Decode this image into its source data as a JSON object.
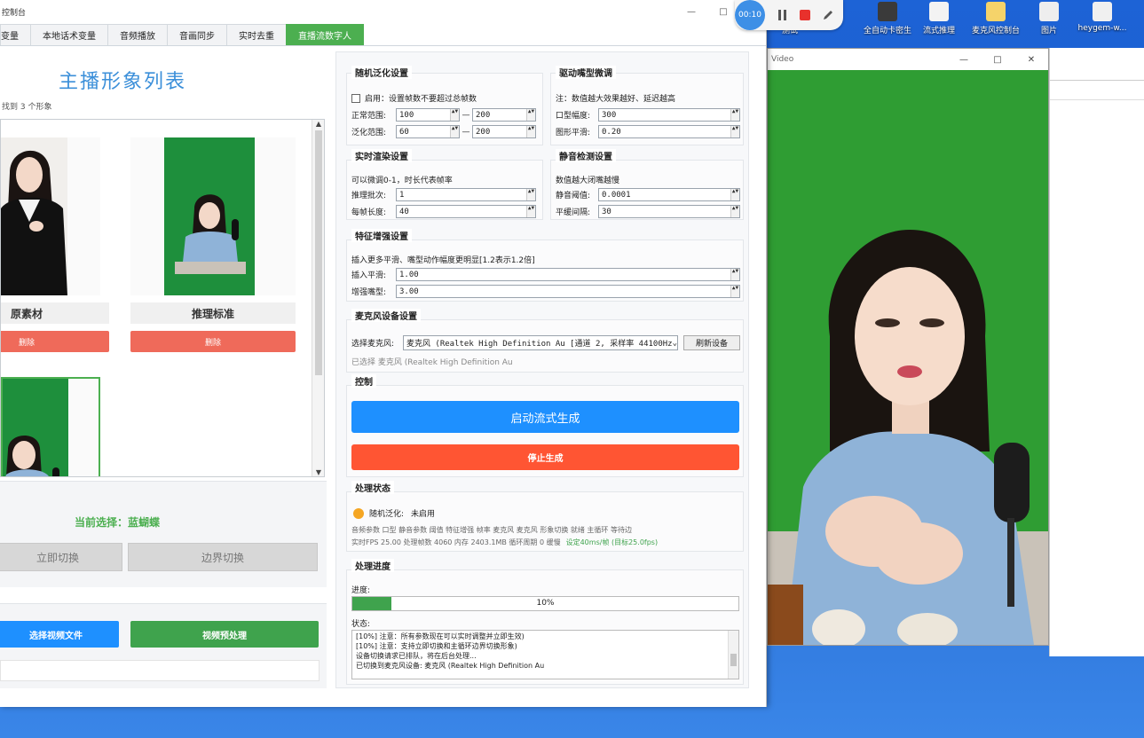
{
  "desktop": {
    "icons": [
      {
        "label": "测试",
        "color": "#d6d6d6"
      },
      {
        "label": "全自动卡密生",
        "color": "#3a3a3a"
      },
      {
        "label": "流式推理",
        "color": "#f3f3f3"
      },
      {
        "label": "麦克风控制台",
        "color": "#f5d36a"
      },
      {
        "label": "图片",
        "color": "#eeeeee"
      },
      {
        "label": "heygem-w...",
        "color": "#f0f0f0"
      }
    ]
  },
  "recorder": {
    "time": "00:10"
  },
  "window": {
    "title": "控制台",
    "min": "—",
    "max": "□",
    "close": "✕"
  },
  "tabs": [
    {
      "label": "变量",
      "active": false
    },
    {
      "label": "本地话术变量",
      "active": false
    },
    {
      "label": "音频播放",
      "active": false
    },
    {
      "label": "音画同步",
      "active": false
    },
    {
      "label": "实时去重",
      "active": false
    },
    {
      "label": "直播流数字人",
      "active": true
    }
  ],
  "left": {
    "title": "主播形象列表",
    "count_text": "找到 3 个形象",
    "avatars": [
      {
        "name": "原素材",
        "delete": "删除"
      },
      {
        "name": "推理标准",
        "delete": "删除"
      },
      {
        "name": "",
        "delete": ""
      }
    ],
    "current_selection": "当前选择：蓝蝴蝶",
    "switch_now": "立即切换",
    "switch_boundary": "边界切换",
    "select_video": "选择视频文件",
    "preprocess": "视频预处理"
  },
  "settings": {
    "random": {
      "title": "随机泛化设置",
      "enable_label": "启用：设置帧数不要超过总帧数",
      "normal_label": "正常范围:",
      "normal_min": "100",
      "normal_max": "200",
      "general_label": "泛化范围:",
      "general_min": "60",
      "general_max": "200",
      "dash": "—"
    },
    "mouth": {
      "title": "驱动嘴型微调",
      "note": "注：数值越大效果越好、延迟越高",
      "amp_label": "口型幅度:",
      "amp_value": "300",
      "smooth_label": "图形平滑:",
      "smooth_value": "0.20"
    },
    "render": {
      "title": "实时渲染设置",
      "note": "可以微调0-1，时长代表帧率",
      "batch_label": "推理批次:",
      "batch_value": "1",
      "frame_label": "每帧长度:",
      "frame_value": "40"
    },
    "silence": {
      "title": "静音检测设置",
      "note": "数值越大闭嘴越慢",
      "threshold_label": "静音阈值:",
      "threshold_value": "0.0001",
      "smooth_label": "平缓间隔:",
      "smooth_value": "30"
    },
    "feature": {
      "title": "特征增强设置",
      "note": "插入更多平滑、嘴型动作幅度更明显[1.2表示1.2倍]",
      "insert_label": "插入平滑:",
      "insert_value": "1.00",
      "mouth_label": "增强嘴型:",
      "mouth_value": "3.00"
    },
    "mic": {
      "title": "麦克风设备设置",
      "select_label": "选择麦克风:",
      "device": "麦克风 (Realtek High Definition Au [通道 2, 采样率 44100Hz",
      "refresh": "刷新设备",
      "selected": "已选择  麦克风 (Realtek High Definition Au"
    },
    "control": {
      "title": "控制",
      "start": "启动流式生成",
      "stop": "停止生成"
    },
    "status": {
      "title": "处理状态",
      "random_label": "随机泛化:",
      "random_value": "未启用",
      "params_line": "音频参数  口型  静音参数  阈值  特征增强  帧率  麦克风  麦克风  形象切换  就绪  主循环  等待边",
      "perf_line": "实时FPS  25.00  处理帧数  4060  内存  2403.1MB  循环周期  0  缓慢",
      "perf_ok": "设定40ms/帧 (目标25.0fps)"
    },
    "progress": {
      "title": "处理进度",
      "progress_label": "进度:",
      "percent": 0.1,
      "percent_text": "10%",
      "status_label": "状态:",
      "log": [
        "[10%] 注意：所有参数现在可以实时调整并立即生效)",
        "[10%] 注意：支持立即切换和主循环边界切换形象)",
        "设备切换请求已排队，将在后台处理...",
        "已切换到麦克风设备: 麦克风 (Realtek High Definition Au"
      ]
    }
  },
  "video_window": {
    "title": "Video",
    "min": "—",
    "max": "□",
    "close": "✕"
  },
  "colors": {
    "accent_blue": "#1e90ff",
    "stop_red": "#ff5533",
    "green": "#4caf50",
    "delete_red": "#ef6a5a",
    "screen_green": "#2e9b2e"
  }
}
